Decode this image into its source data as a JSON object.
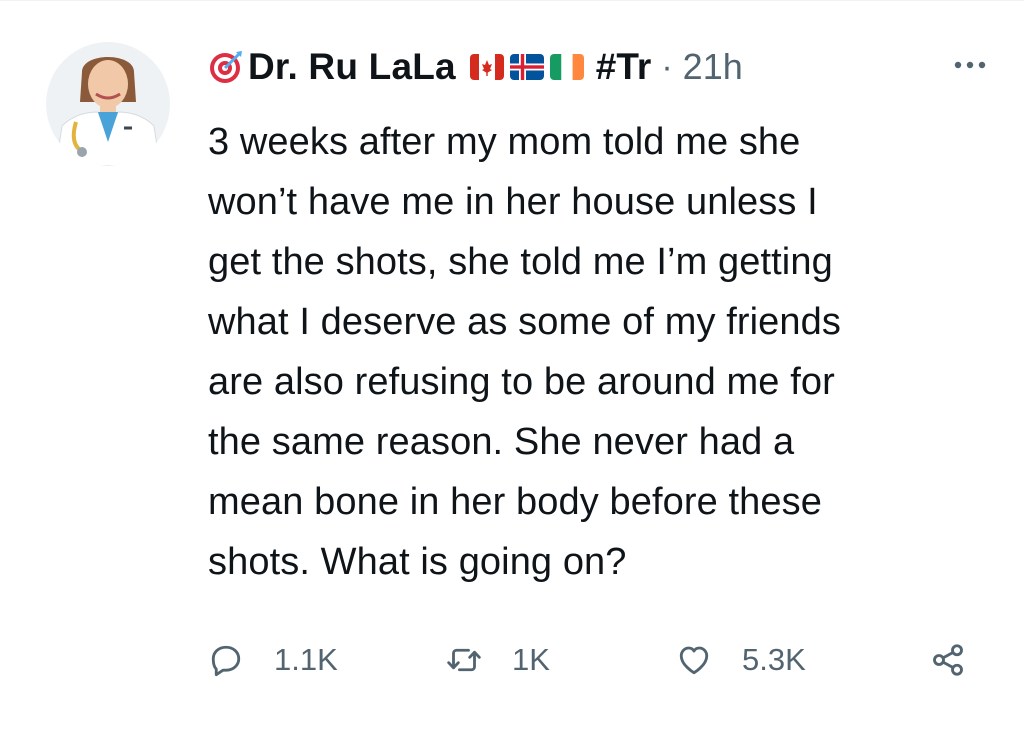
{
  "tweet": {
    "author": {
      "display_name": "Dr. Ru LaLa",
      "prefix_icon": "direct-hit-target-icon",
      "flags": [
        "canada-flag-icon",
        "iceland-flag-icon",
        "ireland-flag-icon"
      ],
      "hashtag": "#Tr",
      "separator": "·",
      "timestamp": "21h"
    },
    "text_lines": [
      "3 weeks after my mom told me she",
      "won’t have me in her house unless I",
      "get the shots, she told me I’m getting",
      "what I deserve as some of my friends",
      "are also refusing to be around me for",
      "the same reason. She never had a",
      "mean bone in her body before these",
      "shots. What is going on?"
    ],
    "actions": {
      "reply_count": "1.1K",
      "retweet_count": "1K",
      "like_count": "5.3K"
    }
  },
  "colors": {
    "text": "#0f1419",
    "secondary": "#536471",
    "divider": "#eff3f4"
  }
}
